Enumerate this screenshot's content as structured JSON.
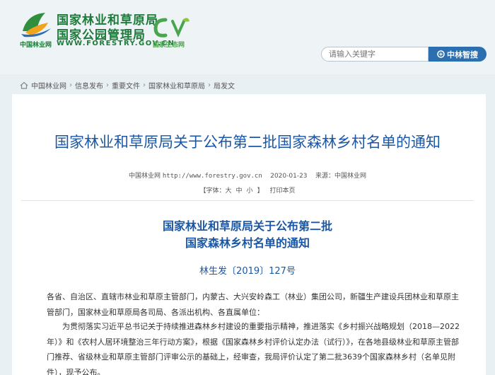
{
  "header": {
    "title_line1": "国家林业和草原局",
    "title_line2": "国家公园管理局",
    "site_name": "中国林业网",
    "url": "WWW.FORESTRY.GOV.CN",
    "eco_label": "国家生态网",
    "search_placeholder": "请输入关键字",
    "search_button": "中林智搜"
  },
  "breadcrumb": {
    "items": [
      "中国林业网",
      "信息发布",
      "重要文件",
      "国家林业和草原局",
      "局发文"
    ]
  },
  "article": {
    "title": "国家林业和草原局关于公布第二批国家森林乡村名单的通知",
    "source_site": "中国林业网",
    "source_url": "http://www.forestry.gov.cn",
    "date": "2020-01-23",
    "source_label": "来源：中国林业网",
    "font_label": "【字体：大",
    "font_mid": "中",
    "font_small": "小",
    "font_close": "】",
    "print": "打印本页",
    "doc_title_line1": "国家林业和草原局关于公布第二批",
    "doc_title_line2": "国家森林乡村名单的通知",
    "doc_number": "林生发〔2019〕127号",
    "para1": "各省、自治区、直辖市林业和草原主管部门，内蒙古、大兴安岭森工（林业）集团公司，新疆生产建设兵团林业和草原主管部门，国家林业和草原局各司局、各派出机构、各直属单位：",
    "para2": "为贯彻落实习近平总书记关于持续推进森林乡村建设的重要指示精神，推进落实《乡村振兴战略规划（2018—2022年）》和《农村人居环境整治三年行动方案》，根据《国家森林乡村评价认定办法（试行）》，在各地县级林业和草原主管部门推荐、省级林业和草原主管部门评审公示的基础上，经审查，我局评价认定了第二批3639个国家森林乡村（名单见附件），现予公布。"
  },
  "colors": {
    "brand_green": "#1d7b3a",
    "title_blue": "#1b57a4",
    "search_blue": "#2b6fb0"
  }
}
